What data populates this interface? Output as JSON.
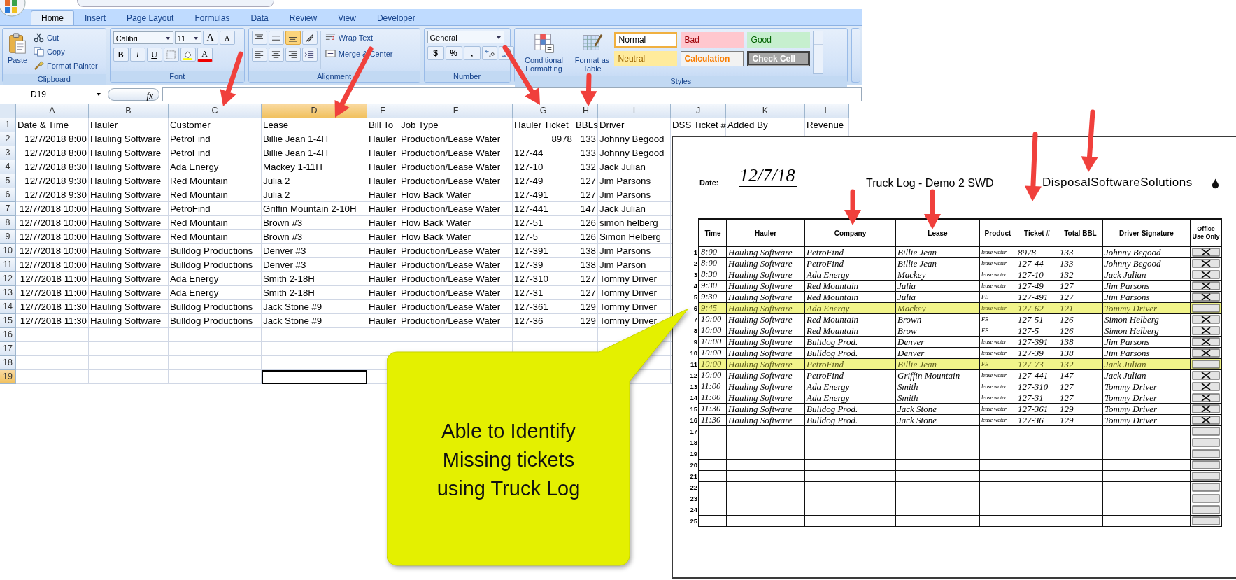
{
  "ribbon": {
    "tabs": [
      {
        "label": "Home",
        "selected": true
      },
      {
        "label": "Insert",
        "selected": false
      },
      {
        "label": "Page Layout",
        "selected": false
      },
      {
        "label": "Formulas",
        "selected": false
      },
      {
        "label": "Data",
        "selected": false
      },
      {
        "label": "Review",
        "selected": false
      },
      {
        "label": "View",
        "selected": false
      },
      {
        "label": "Developer",
        "selected": false
      }
    ],
    "clipboard": {
      "title": "Clipboard",
      "paste": "Paste",
      "cut": "Cut",
      "copy": "Copy",
      "painter": "Format Painter"
    },
    "font": {
      "title": "Font",
      "family": "Calibri",
      "size": "11",
      "grow": "A",
      "shrink": "A",
      "bold": "B",
      "italic": "I",
      "underline": "U",
      "font_color_label": "A"
    },
    "alignment": {
      "title": "Alignment",
      "wrap": "Wrap Text",
      "merge": "Merge & Center"
    },
    "number": {
      "title": "Number",
      "format": "General",
      "currency": "$",
      "percent": "%",
      "comma": ","
    },
    "styles": {
      "title": "Styles",
      "conditional": "Conditional Formatting",
      "format_table": "Format as Table",
      "cells": [
        {
          "label": "Normal",
          "kind": "normal"
        },
        {
          "label": "Bad",
          "kind": "bad"
        },
        {
          "label": "Good",
          "kind": "good"
        },
        {
          "label": "Neutral",
          "kind": "neutral"
        },
        {
          "label": "Calculation",
          "kind": "calculation"
        },
        {
          "label": "Check Cell",
          "kind": "check"
        }
      ]
    }
  },
  "formula_bar": {
    "name_box": "D19",
    "fx": "fx"
  },
  "sheet": {
    "columns": [
      {
        "letter": "A",
        "selected": false
      },
      {
        "letter": "B",
        "selected": false
      },
      {
        "letter": "C",
        "selected": false
      },
      {
        "letter": "D",
        "selected": true
      },
      {
        "letter": "E",
        "selected": false
      },
      {
        "letter": "F",
        "selected": false
      },
      {
        "letter": "G",
        "selected": false
      },
      {
        "letter": "H",
        "selected": false
      },
      {
        "letter": "I",
        "selected": false
      },
      {
        "letter": "J",
        "selected": false
      },
      {
        "letter": "K",
        "selected": false
      },
      {
        "letter": "L",
        "selected": false
      }
    ],
    "rows": [
      {
        "number": "1",
        "kind": "header",
        "selected": false,
        "ticket_is_number": false,
        "cells": [
          "Date & Time",
          "Hauler",
          "Customer",
          "Lease",
          "Bill To",
          "Job Type",
          "Hauler Ticket",
          "BBLs",
          "Driver",
          "DSS Ticket #",
          "Added By",
          "Revenue"
        ]
      },
      {
        "number": "2",
        "kind": "record",
        "selected": false,
        "ticket_is_number": true,
        "cells": [
          "12/7/2018 8:00",
          "Hauling Software",
          "PetroFind",
          "Billie Jean 1-4H",
          "Hauler",
          "Production/Lease Water",
          "8978",
          "133",
          "Johnny Begood"
        ]
      },
      {
        "number": "3",
        "kind": "record",
        "selected": false,
        "ticket_is_number": false,
        "cells": [
          "12/7/2018 8:00",
          "Hauling Software",
          "PetroFind",
          "Billie Jean 1-4H",
          "Hauler",
          "Production/Lease Water",
          "127-44",
          "133",
          "Johnny Begood"
        ]
      },
      {
        "number": "4",
        "kind": "record",
        "selected": false,
        "ticket_is_number": false,
        "cells": [
          "12/7/2018 8:30",
          "Hauling Software",
          "Ada Energy",
          "Mackey 1-11H",
          "Hauler",
          "Production/Lease Water",
          "127-10",
          "132",
          "Jack Julian"
        ]
      },
      {
        "number": "5",
        "kind": "record",
        "selected": false,
        "ticket_is_number": false,
        "cells": [
          "12/7/2018 9:30",
          "Hauling Software",
          "Red Mountain",
          "Julia 2",
          "Hauler",
          "Production/Lease Water",
          "127-49",
          "127",
          "Jim Parsons"
        ]
      },
      {
        "number": "6",
        "kind": "record",
        "selected": false,
        "ticket_is_number": false,
        "cells": [
          "12/7/2018 9:30",
          "Hauling Software",
          "Red Mountain",
          "Julia 2",
          "Hauler",
          "Flow Back Water",
          "127-491",
          "127",
          "Jim Parsons"
        ]
      },
      {
        "number": "7",
        "kind": "record",
        "selected": false,
        "ticket_is_number": false,
        "cells": [
          "12/7/2018 10:00",
          "Hauling Software",
          "PetroFind",
          "Griffin Mountain 2-10H",
          "Hauler",
          "Production/Lease Water",
          "127-441",
          "147",
          "Jack Julian"
        ]
      },
      {
        "number": "8",
        "kind": "record",
        "selected": false,
        "ticket_is_number": false,
        "cells": [
          "12/7/2018 10:00",
          "Hauling Software",
          "Red Mountain",
          "Brown #3",
          "Hauler",
          "Flow Back Water",
          "127-51",
          "126",
          "simon helberg"
        ]
      },
      {
        "number": "9",
        "kind": "record",
        "selected": false,
        "ticket_is_number": false,
        "cells": [
          "12/7/2018 10:00",
          "Hauling Software",
          "Red Mountain",
          "Brown #3",
          "Hauler",
          "Flow Back Water",
          "127-5",
          "126",
          "Simon Helberg"
        ]
      },
      {
        "number": "10",
        "kind": "record",
        "selected": false,
        "ticket_is_number": false,
        "cells": [
          "12/7/2018 10:00",
          "Hauling Software",
          "Bulldog Productions",
          "Denver #3",
          "Hauler",
          "Production/Lease Water",
          "127-391",
          "138",
          "Jim Parsons"
        ]
      },
      {
        "number": "11",
        "kind": "record",
        "selected": false,
        "ticket_is_number": false,
        "cells": [
          "12/7/2018 10:00",
          "Hauling Software",
          "Bulldog Productions",
          "Denver #3",
          "Hauler",
          "Production/Lease Water",
          "127-39",
          "138",
          "Jim Parson"
        ]
      },
      {
        "number": "12",
        "kind": "record",
        "selected": false,
        "ticket_is_number": false,
        "cells": [
          "12/7/2018 11:00",
          "Hauling Software",
          "Ada Energy",
          "Smith 2-18H",
          "Hauler",
          "Production/Lease Water",
          "127-310",
          "127",
          "Tommy Driver"
        ]
      },
      {
        "number": "13",
        "kind": "record",
        "selected": false,
        "ticket_is_number": false,
        "cells": [
          "12/7/2018 11:00",
          "Hauling Software",
          "Ada Energy",
          "Smith 2-18H",
          "Hauler",
          "Production/Lease Water",
          "127-31",
          "127",
          "Tommy Driver"
        ]
      },
      {
        "number": "14",
        "kind": "record",
        "selected": false,
        "ticket_is_number": false,
        "cells": [
          "12/7/2018 11:30",
          "Hauling Software",
          "Bulldog Productions",
          "Jack Stone #9",
          "Hauler",
          "Production/Lease Water",
          "127-361",
          "129",
          "Tommy Driver"
        ]
      },
      {
        "number": "15",
        "kind": "record",
        "selected": false,
        "ticket_is_number": false,
        "cells": [
          "12/7/2018 11:30",
          "Hauling Software",
          "Bulldog Productions",
          "Jack Stone #9",
          "Hauler",
          "Production/Lease Water",
          "127-36",
          "129",
          "Tommy Driver"
        ]
      }
    ],
    "empty_rows": [
      {
        "number": "16",
        "selected": false
      },
      {
        "number": "17",
        "selected": false
      },
      {
        "number": "18",
        "selected": false
      },
      {
        "number": "19",
        "selected": true
      }
    ]
  },
  "truck_log": {
    "date_label": "Date:",
    "date": "12/7/18",
    "title": "Truck Log - Demo 2 SWD",
    "logo": "DisposalSoftwareSolutions",
    "columns": [
      "Time",
      "Hauler",
      "Company",
      "Lease",
      "Product",
      "Ticket #",
      "Total BBL",
      "Driver Signature",
      "Office Use Only"
    ],
    "rows": [
      {
        "number": "1",
        "time": "8:00",
        "hauler": "Hauling Software",
        "company": "PetroFind",
        "lease": "Billie Jean",
        "product": "lease water",
        "ticket": "8978",
        "bbl": "133",
        "driver": "Johnny Begood",
        "highlighted": false,
        "checked": true
      },
      {
        "number": "2",
        "time": "8:00",
        "hauler": "Hauling Software",
        "company": "PetroFind",
        "lease": "Billie Jean",
        "product": "lease water",
        "ticket": "127-44",
        "bbl": "133",
        "driver": "Johnny Begood",
        "highlighted": false,
        "checked": true
      },
      {
        "number": "3",
        "time": "8:30",
        "hauler": "Hauling Software",
        "company": "Ada Energy",
        "lease": "Mackey",
        "product": "lease water",
        "ticket": "127-10",
        "bbl": "132",
        "driver": "Jack Julian",
        "highlighted": false,
        "checked": true
      },
      {
        "number": "4",
        "time": "9:30",
        "hauler": "Hauling Software",
        "company": "Red Mountain",
        "lease": "Julia",
        "product": "lease water",
        "ticket": "127-49",
        "bbl": "127",
        "driver": "Jim Parsons",
        "highlighted": false,
        "checked": true
      },
      {
        "number": "5",
        "time": "9:30",
        "hauler": "Hauling Software",
        "company": "Red Mountain",
        "lease": "Julia",
        "product": "FB",
        "ticket": "127-491",
        "bbl": "127",
        "driver": "Jim Parsons",
        "highlighted": false,
        "checked": true
      },
      {
        "number": "6",
        "time": "9:45",
        "hauler": "Hauling Software",
        "company": "Ada Energy",
        "lease": "Mackey",
        "product": "lease water",
        "ticket": "127-62",
        "bbl": "121",
        "driver": "Tommy Driver",
        "highlighted": true,
        "checked": false
      },
      {
        "number": "7",
        "time": "10:00",
        "hauler": "Hauling Software",
        "company": "Red Mountain",
        "lease": "Brown",
        "product": "FB",
        "ticket": "127-51",
        "bbl": "126",
        "driver": "Simon Helberg",
        "highlighted": false,
        "checked": true
      },
      {
        "number": "8",
        "time": "10:00",
        "hauler": "Hauling Software",
        "company": "Red Mountain",
        "lease": "Brow",
        "product": "FB",
        "ticket": "127-5",
        "bbl": "126",
        "driver": "Simon Helberg",
        "highlighted": false,
        "checked": true
      },
      {
        "number": "9",
        "time": "10:00",
        "hauler": "Hauling Software",
        "company": "Bulldog Prod.",
        "lease": "Denver",
        "product": "lease water",
        "ticket": "127-391",
        "bbl": "138",
        "driver": "Jim Parsons",
        "highlighted": false,
        "checked": true
      },
      {
        "number": "10",
        "time": "10:00",
        "hauler": "Hauling Software",
        "company": "Bulldog Prod.",
        "lease": "Denver",
        "product": "lease water",
        "ticket": "127-39",
        "bbl": "138",
        "driver": "Jim Parsons",
        "highlighted": false,
        "checked": true
      },
      {
        "number": "11",
        "time": "10:00",
        "hauler": "Hauling Software",
        "company": "PetroFind",
        "lease": "Billie Jean",
        "product": "FB",
        "ticket": "127-73",
        "bbl": "132",
        "driver": "Jack Julian",
        "highlighted": true,
        "checked": false
      },
      {
        "number": "12",
        "time": "10:00",
        "hauler": "Hauling Software",
        "company": "PetroFind",
        "lease": "Griffin Mountain",
        "product": "lease water",
        "ticket": "127-441",
        "bbl": "147",
        "driver": "Jack Julian",
        "highlighted": false,
        "checked": true
      },
      {
        "number": "13",
        "time": "11:00",
        "hauler": "Hauling Software",
        "company": "Ada Energy",
        "lease": "Smith",
        "product": "lease water",
        "ticket": "127-310",
        "bbl": "127",
        "driver": "Tommy Driver",
        "highlighted": false,
        "checked": true
      },
      {
        "number": "14",
        "time": "11:00",
        "hauler": "Hauling Software",
        "company": "Ada Energy",
        "lease": "Smith",
        "product": "lease water",
        "ticket": "127-31",
        "bbl": "127",
        "driver": "Tommy Driver",
        "highlighted": false,
        "checked": true
      },
      {
        "number": "15",
        "time": "11:30",
        "hauler": "Hauling Software",
        "company": "Bulldog Prod.",
        "lease": "Jack Stone",
        "product": "lease water",
        "ticket": "127-361",
        "bbl": "129",
        "driver": "Tommy Driver",
        "highlighted": false,
        "checked": true
      },
      {
        "number": "16",
        "time": "11:30",
        "hauler": "Hauling Software",
        "company": "Bulldog Prod.",
        "lease": "Jack Stone",
        "product": "lease water",
        "ticket": "127-36",
        "bbl": "129",
        "driver": "Tommy Driver",
        "highlighted": false,
        "checked": true
      },
      {
        "number": "17",
        "highlighted": false,
        "checked": false
      },
      {
        "number": "18",
        "highlighted": false,
        "checked": false
      },
      {
        "number": "19",
        "highlighted": false,
        "checked": false
      },
      {
        "number": "20",
        "highlighted": false,
        "checked": false
      },
      {
        "number": "21",
        "highlighted": false,
        "checked": false
      },
      {
        "number": "22",
        "highlighted": false,
        "checked": false
      },
      {
        "number": "23",
        "highlighted": false,
        "checked": false
      },
      {
        "number": "24",
        "highlighted": false,
        "checked": false
      },
      {
        "number": "25",
        "highlighted": false,
        "checked": false
      }
    ]
  },
  "callout": {
    "text": "Able to Identify\nMissing tickets\nusing Truck Log"
  }
}
